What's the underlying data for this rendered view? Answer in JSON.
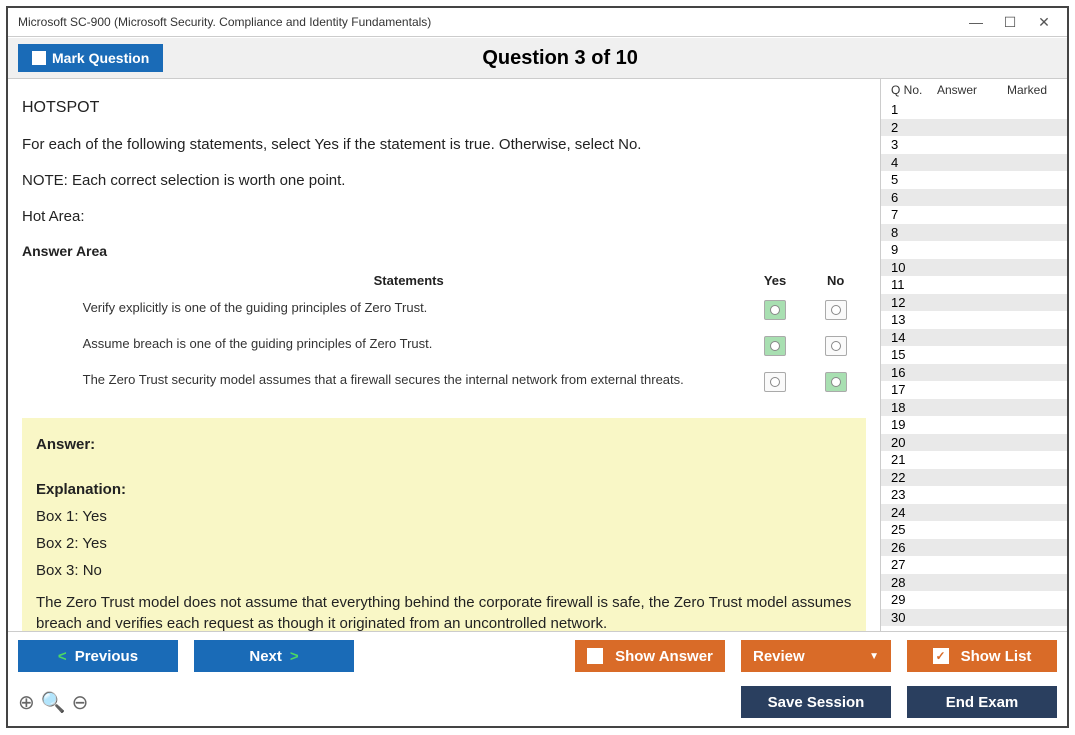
{
  "window": {
    "title": "Microsoft SC-900 (Microsoft Security. Compliance and Identity Fundamentals)"
  },
  "toolbar": {
    "mark_label": "Mark Question",
    "question_title": "Question 3 of 10"
  },
  "question": {
    "hotspot_label": "HOTSPOT",
    "instruction": "For each of the following statements, select Yes if the statement is true. Otherwise, select No.",
    "note": "NOTE: Each correct selection is worth one point.",
    "hot_area_label": "Hot Area:",
    "answer_area_label": "Answer Area",
    "col_statements": "Statements",
    "col_yes": "Yes",
    "col_no": "No",
    "statements": [
      {
        "text": "Verify explicitly is one of the guiding principles of Zero Trust.",
        "yes_sel": true,
        "no_sel": false
      },
      {
        "text": "Assume breach is one of the guiding principles of Zero Trust.",
        "yes_sel": true,
        "no_sel": false
      },
      {
        "text": "The Zero Trust security model assumes that a firewall secures the internal network from external threats.",
        "yes_sel": false,
        "no_sel": true
      }
    ]
  },
  "answer": {
    "label": "Answer:",
    "explanation_label": "Explanation:",
    "lines": [
      "Box 1: Yes",
      "Box 2: Yes",
      "Box 3: No"
    ],
    "para": "The Zero Trust model does not assume that everything behind the corporate firewall is safe, the Zero Trust model assumes breach and verifies each request as though it originated from an uncontrolled network."
  },
  "sidepanel": {
    "h_qno": "Q No.",
    "h_answer": "Answer",
    "h_marked": "Marked",
    "rows": [
      1,
      2,
      3,
      4,
      5,
      6,
      7,
      8,
      9,
      10,
      11,
      12,
      13,
      14,
      15,
      16,
      17,
      18,
      19,
      20,
      21,
      22,
      23,
      24,
      25,
      26,
      27,
      28,
      29,
      30
    ]
  },
  "footer": {
    "previous": "Previous",
    "next": "Next",
    "show_answer": "Show Answer",
    "review": "Review",
    "show_list": "Show List",
    "save_session": "Save Session",
    "end_exam": "End Exam"
  }
}
